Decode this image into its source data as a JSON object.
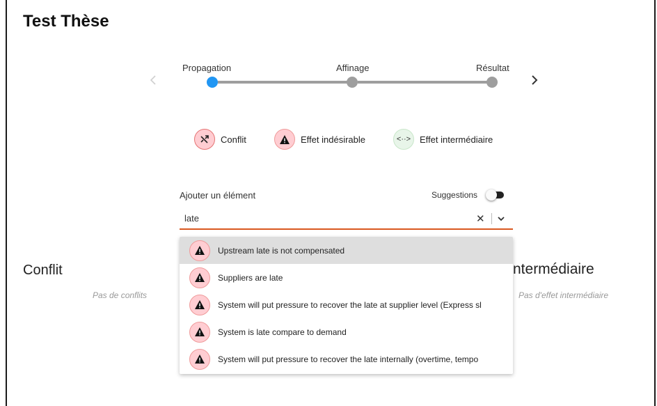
{
  "app": {
    "title": "Test Thèse"
  },
  "stepper": {
    "steps": [
      {
        "label": "Propagation",
        "active": true
      },
      {
        "label": "Affinage",
        "active": false
      },
      {
        "label": "Résultat",
        "active": false
      }
    ],
    "active_color": "#2196f3",
    "inactive_color": "#9e9e9e"
  },
  "legend": [
    {
      "label": "Conflit",
      "icon": "shuffle-icon"
    },
    {
      "label": "Effet indésirable",
      "icon": "warning-icon"
    },
    {
      "label": "Effet intermédiaire",
      "icon": "arrows-horizontal-icon",
      "symbol": "<··>"
    }
  ],
  "add_element": {
    "label": "Ajouter un élément",
    "suggestions_label": "Suggestions",
    "suggestions_enabled": false,
    "input_value": "late",
    "clear_symbol": "✕",
    "accent_color": "#d9571f"
  },
  "dropdown": {
    "options": [
      {
        "text": "Upstream late is not compensated",
        "highlighted": true
      },
      {
        "text": "Suppliers are late",
        "highlighted": false
      },
      {
        "text": "System will put pressure to recover the late at supplier level (Express sl",
        "highlighted": false
      },
      {
        "text": "System is late compare to demand",
        "highlighted": false
      },
      {
        "text": "System will put pressure to recover the late internally (overtime, tempo",
        "highlighted": false
      }
    ]
  },
  "sections": {
    "left_title": "Conflit",
    "left_empty": "Pas de conflits",
    "right_title": "ntermédiaire",
    "right_empty": "Pas d'effet intermédiaire"
  }
}
